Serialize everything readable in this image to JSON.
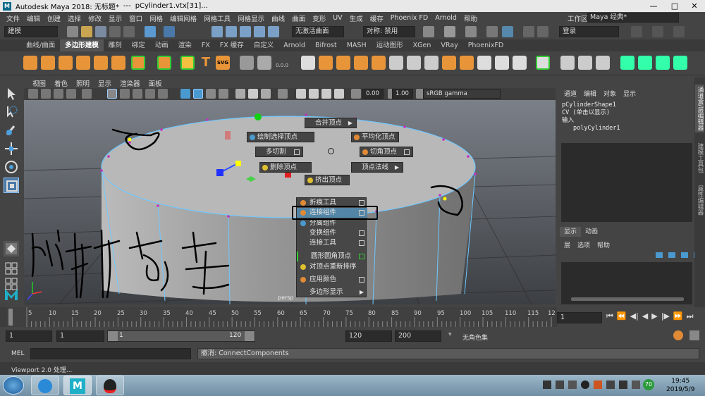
{
  "titlebar": {
    "app": "Autodesk Maya 2018: 无标题*",
    "sep": "---",
    "file": "pCylinder1.vtx[31]...",
    "min": "—",
    "max": "□",
    "close": "✕"
  },
  "menubar": {
    "items": [
      "文件",
      "编辑",
      "创建",
      "选择",
      "修改",
      "显示",
      "窗口",
      "网格",
      "编辑网格",
      "网格工具",
      "网格显示",
      "曲线",
      "曲面",
      "变形",
      "UV",
      "生成",
      "缓存",
      "Phoenix FD",
      "Arnold",
      "帮助"
    ],
    "workspace_label": "工作区:",
    "workspace_value": "Maya 经典*"
  },
  "statusline": {
    "mode": "建模",
    "live_surface": "无激活曲面",
    "symmetry": "对称: 禁用",
    "login": "登录"
  },
  "shelf": {
    "tabs": [
      "曲线/曲面",
      "多边形建模",
      "雕刻",
      "绑定",
      "动画",
      "渲染",
      "FX",
      "FX 缓存",
      "自定义",
      "Arnold",
      "Bifrost",
      "MASH",
      "运动图形",
      "XGen",
      "VRay",
      "PhoenixFD"
    ],
    "active_tab": "多边形建模",
    "text_icon": "T",
    "svg_icon": "SVG",
    "value_icon": "0.0.0"
  },
  "panel": {
    "menus": [
      "视图",
      "着色",
      "照明",
      "显示",
      "渲染器",
      "面板"
    ],
    "exposure": "0.00",
    "gamma": "1.00",
    "colorspace": "sRGB gamma",
    "camera_label": "persp"
  },
  "marking_menu": {
    "merge": "合并顶点",
    "paint_select": "绘制选择顶点",
    "average": "平均化顶点",
    "multicut": "多切割",
    "chamfer": "切角顶点",
    "delete": "删除顶点",
    "normals": "顶点法线",
    "extrude": "挤出顶点"
  },
  "context_menu": {
    "items": [
      "折痕工具",
      "连接组件",
      "分离组件",
      "变换组件",
      "连接工具",
      "圆形圆角顶点",
      "对顶点重新排序",
      "应用颜色",
      "多边形显示"
    ]
  },
  "annotation": {
    "text": "附快右击"
  },
  "channelbox": {
    "menus": [
      "通道",
      "编辑",
      "对象",
      "显示"
    ],
    "shape": "pCylinderShape1",
    "cv": "CV (单击以显示)",
    "inputs": "输入",
    "poly": "polyCylinder1",
    "layer_tabs": [
      "显示",
      "动画"
    ],
    "layer_menus": [
      "层",
      "选项",
      "帮助"
    ],
    "side_tabs": [
      "通道盒/层编辑器",
      "建模工具包",
      "属性编辑器"
    ]
  },
  "timeline": {
    "ticks": [
      "5",
      "10",
      "15",
      "20",
      "25",
      "30",
      "35",
      "40",
      "45",
      "50",
      "55",
      "60",
      "65",
      "70",
      "75",
      "80",
      "85",
      "90",
      "95",
      "100",
      "105",
      "110",
      "115",
      "12"
    ],
    "current_frame": "1"
  },
  "range": {
    "start": "1",
    "start2": "1",
    "slider_start": "1",
    "slider_end": "120",
    "end": "120",
    "end2": "200",
    "char_set": "无角色集"
  },
  "cmdline": {
    "lang": "MEL",
    "result": "撤消: ConnectComponents"
  },
  "helpline": {
    "text": "Viewport 2.0 处理..."
  },
  "taskbar": {
    "time": "19:45",
    "date": "2019/5/9",
    "battery": "70"
  }
}
